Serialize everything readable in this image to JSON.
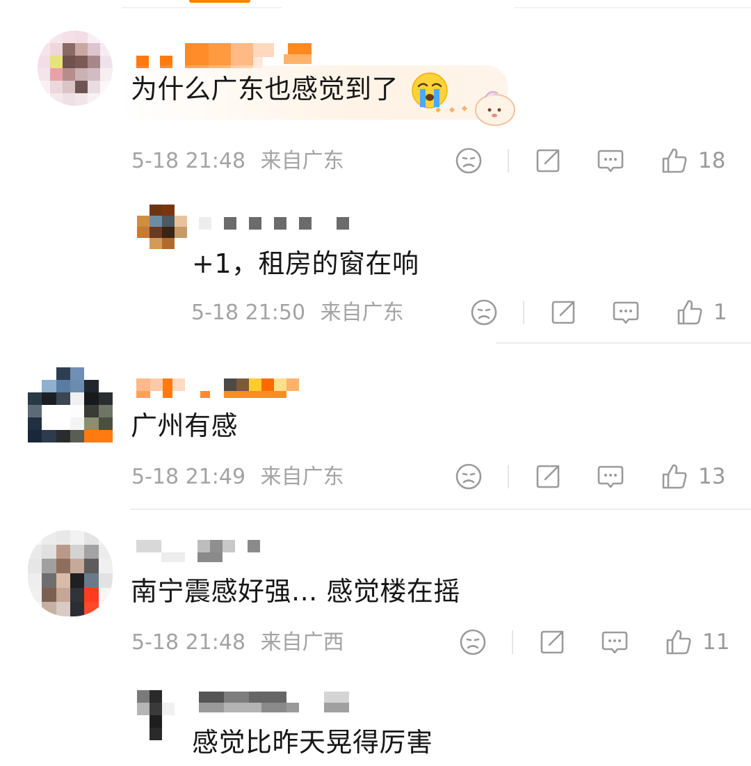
{
  "colors": {
    "text": "#161616",
    "meta": "#a3a3a3",
    "icon": "#9a9a9a",
    "accent": "#ff8200"
  },
  "icons": {
    "dislike": "sad-face-icon",
    "share": "share-icon",
    "reply": "comment-bubble-icon",
    "like": "thumbs-up-icon"
  },
  "comments": [
    {
      "text": "为什么广东也感觉到了",
      "emoji": "crying-face-emoji",
      "time": "5-18 21:48",
      "location": "来自广东",
      "likes": "18"
    },
    {
      "text": "+1，租房的窗在响",
      "time": "5-18 21:50",
      "location": "来自广东",
      "likes": "1"
    },
    {
      "text": "广州有感",
      "time": "5-18 21:49",
      "location": "来自广东",
      "likes": "13"
    },
    {
      "text": "南宁震感好强... 感觉楼在摇",
      "time": "5-18 21:48",
      "location": "来自广西",
      "likes": "11"
    },
    {
      "text": "感觉比昨天晃得厉害"
    }
  ]
}
